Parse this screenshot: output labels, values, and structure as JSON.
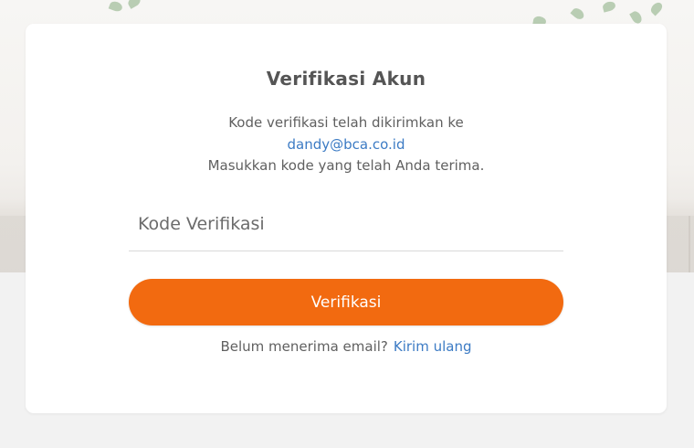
{
  "card": {
    "title": "Verifikasi Akun",
    "description_line1": "Kode verifikasi telah dikirimkan ke",
    "email": "dandy@bca.co.id",
    "description_line3": "Masukkan kode yang telah Anda terima."
  },
  "form": {
    "code_placeholder": "Kode Verifikasi",
    "code_value": "",
    "submit_label": "Verifikasi"
  },
  "resend": {
    "prompt": "Belum menerima email?",
    "link_label": "Kirim ulang"
  },
  "colors": {
    "accent": "#f26a10",
    "link": "#3c7bc4",
    "title_text": "#555555",
    "body_text": "#606060",
    "card_background": "#ffffff",
    "page_background": "#f2f2f2"
  }
}
